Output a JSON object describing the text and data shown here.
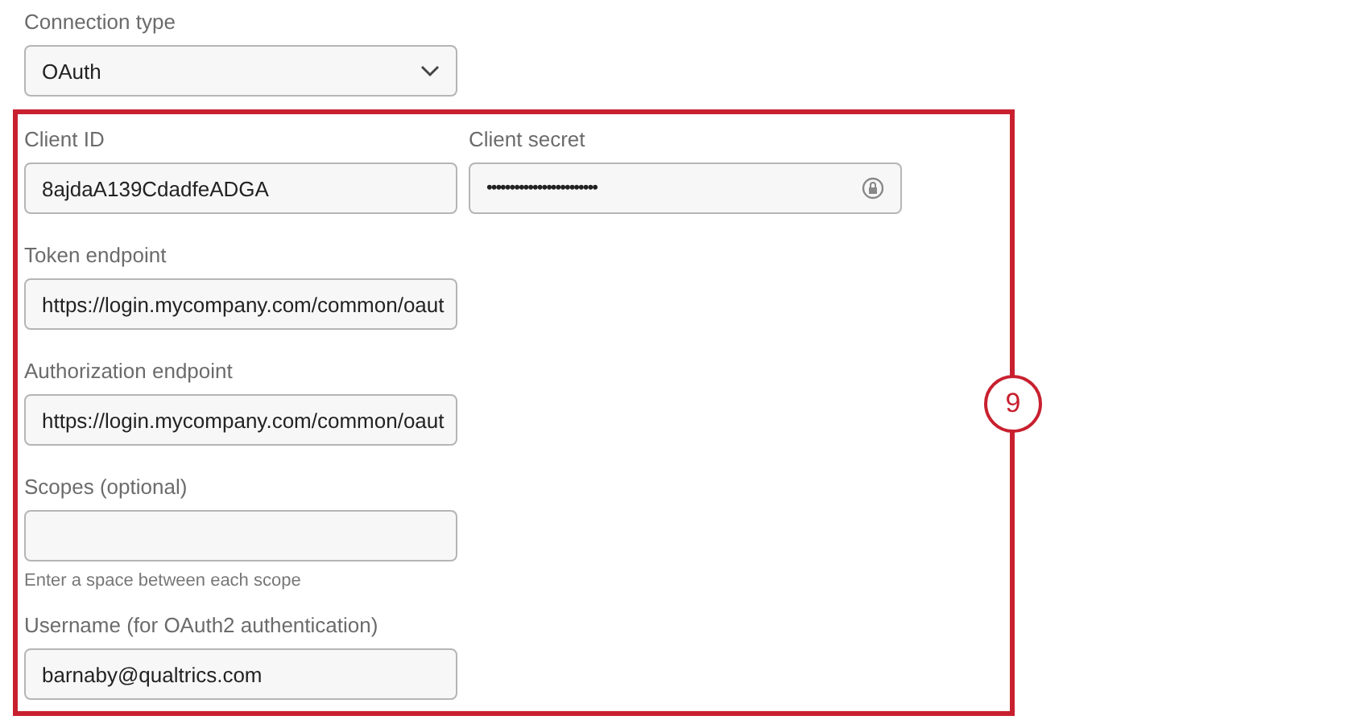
{
  "connection_type": {
    "label": "Connection type",
    "value": "OAuth"
  },
  "section": {
    "badge": "9",
    "rows": [
      [
        {
          "label": "Client ID",
          "value": "8ajdaA139CdadfeADGA",
          "kind": "text"
        },
        {
          "label": "Client secret",
          "value": "••••••••••••••••••••••••",
          "kind": "secret"
        }
      ],
      [
        {
          "label": "Token endpoint",
          "value": "https://login.mycompany.com/common/oaut",
          "kind": "text"
        }
      ],
      [
        {
          "label": "Authorization endpoint",
          "value": "https://login.mycompany.com/common/oaut",
          "kind": "text"
        }
      ],
      [
        {
          "label": "Scopes (optional)",
          "kind": "text",
          "hint": "Enter a space between each scope"
        }
      ],
      [
        {
          "label": "Username (for OAuth2 authentication)",
          "value": "barnaby@qualtrics.com",
          "kind": "text"
        }
      ]
    ]
  }
}
